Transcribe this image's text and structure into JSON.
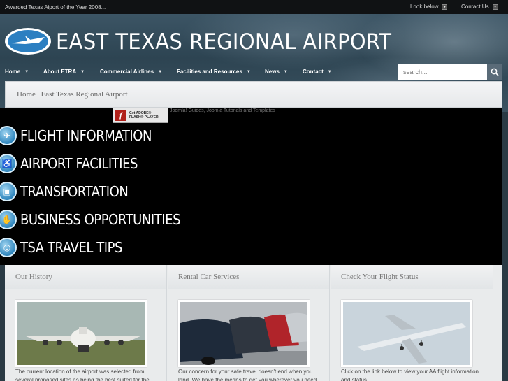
{
  "topbar": {
    "award": "Awarded Texas Aiport of the Year 2008...",
    "look_below": "Look below",
    "contact_us": "Contact Us"
  },
  "header": {
    "title": "EAST TEXAS REGIONAL AIRPORT"
  },
  "nav": {
    "items": [
      {
        "label": "Home"
      },
      {
        "label": "About ETRA"
      },
      {
        "label": "Commercial Airlines"
      },
      {
        "label": "Facilities and Resources"
      },
      {
        "label": "News"
      },
      {
        "label": "Contact"
      }
    ]
  },
  "search": {
    "placeholder": "search..."
  },
  "breadcrumb": "Home | East Texas Regional Airport",
  "flash": {
    "badge_line1": "Get ADOBE®",
    "badge_line2": "FLASH® PLAYER",
    "joomla_text": "Joomla! Guides, Joomla Tutorials and Templates"
  },
  "feature_menu": {
    "items": [
      {
        "label": "FLIGHT INFORMATION",
        "icon": "plane-icon"
      },
      {
        "label": "AIRPORT FACILITIES",
        "icon": "wheelchair-icon"
      },
      {
        "label": "TRANSPORTATION",
        "icon": "bus-icon"
      },
      {
        "label": "BUSINESS OPPORTUNITIES",
        "icon": "handshake-icon"
      },
      {
        "label": "TSA TRAVEL TIPS",
        "icon": "binoculars-icon"
      }
    ]
  },
  "columns": [
    {
      "heading": "Our History",
      "text": "The current location of the airport was selected from several proposed sites as being the best suited for the"
    },
    {
      "heading": "Rental Car Services",
      "text": "Our concern for your safe travel doesn't end when you land. We have the means to get you wherever you need"
    },
    {
      "heading": "Check Your Flight Status",
      "text": "Click on the link below to view your AA flight information and status"
    }
  ],
  "colors": {
    "topbar_bg": "#101214",
    "stage_bg": "#000000",
    "accent_blue": "#2f86be"
  }
}
